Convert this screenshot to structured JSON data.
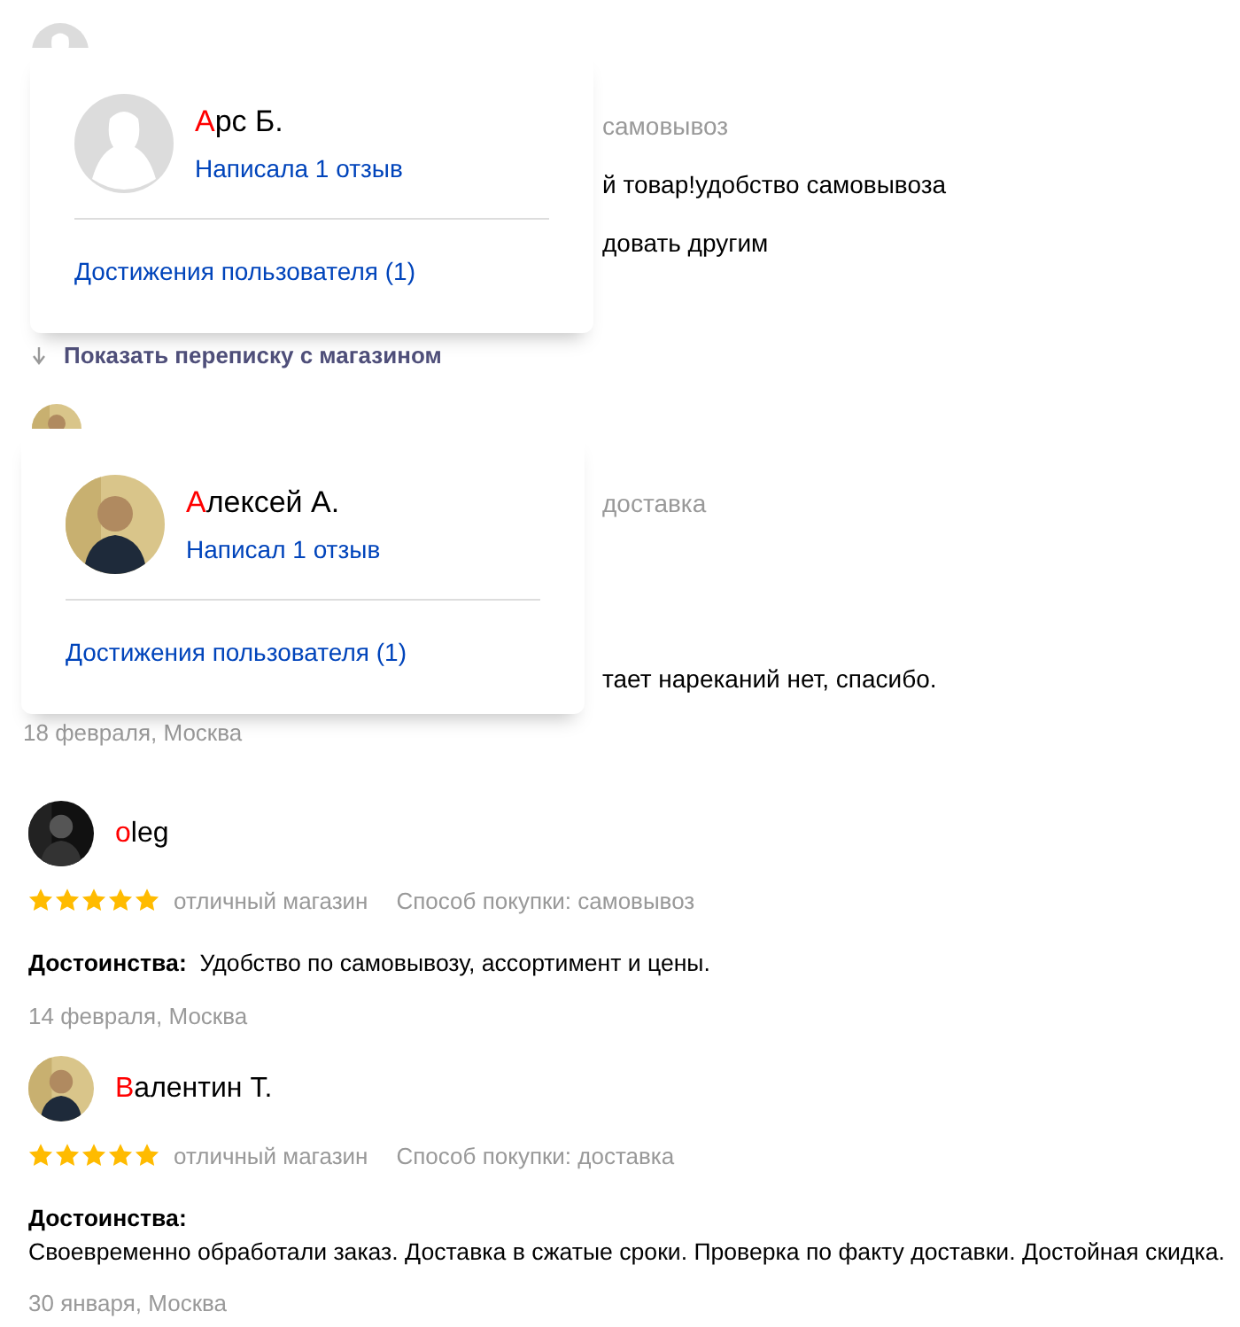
{
  "reviews": [
    {
      "kind": "covered",
      "avatar": {
        "kind": "default"
      },
      "fragments": [
        {
          "kind": "meta",
          "text": "самовывоз"
        },
        {
          "kind": "body",
          "text": "й товар!удобство самовывоза"
        },
        {
          "kind": "body",
          "text": "довать другим"
        }
      ],
      "correspondence_link": "Показать переписку с магазином",
      "popup": {
        "avatar": {
          "kind": "default"
        },
        "name": "Арс Б.",
        "reviews_link": "Написала 1 отзыв",
        "achievements_link": "Достижения пользователя (1)"
      }
    },
    {
      "kind": "covered",
      "avatar": {
        "kind": "picture"
      },
      "fragments": [
        {
          "kind": "meta",
          "text": "доставка"
        },
        {
          "kind": "body",
          "text": "тает нареканий нет, спасибо."
        }
      ],
      "date": "18 февраля, Москва",
      "popup": {
        "avatar": {
          "kind": "picture"
        },
        "name": "Алексей А.",
        "reviews_link": "Написал 1 отзыв",
        "achievements_link": "Достижения пользователя (1)"
      }
    },
    {
      "kind": "full",
      "avatar": {
        "kind": "picture"
      },
      "name": "oleg",
      "stars": 5,
      "rating_text": "отличный магазин",
      "purchase": "Способ покупки: самовывоз",
      "pros": {
        "kind": "inline",
        "label": "Достоинства:",
        "text": "Удобство по самовывозу, ассортимент и цены."
      },
      "date": "14 февраля, Москва"
    },
    {
      "kind": "full",
      "avatar": {
        "kind": "picture"
      },
      "name": "Валентин Т.",
      "stars": 5,
      "rating_text": "отличный магазин",
      "purchase": "Способ покупки: доставка",
      "pros": {
        "kind": "block",
        "label": "Достоинства:",
        "text": "Своевременно обработали заказ. Доставка в сжатые сроки. Проверка по факту доставки. Достойная скидка."
      },
      "date": "30 января, Москва"
    }
  ]
}
